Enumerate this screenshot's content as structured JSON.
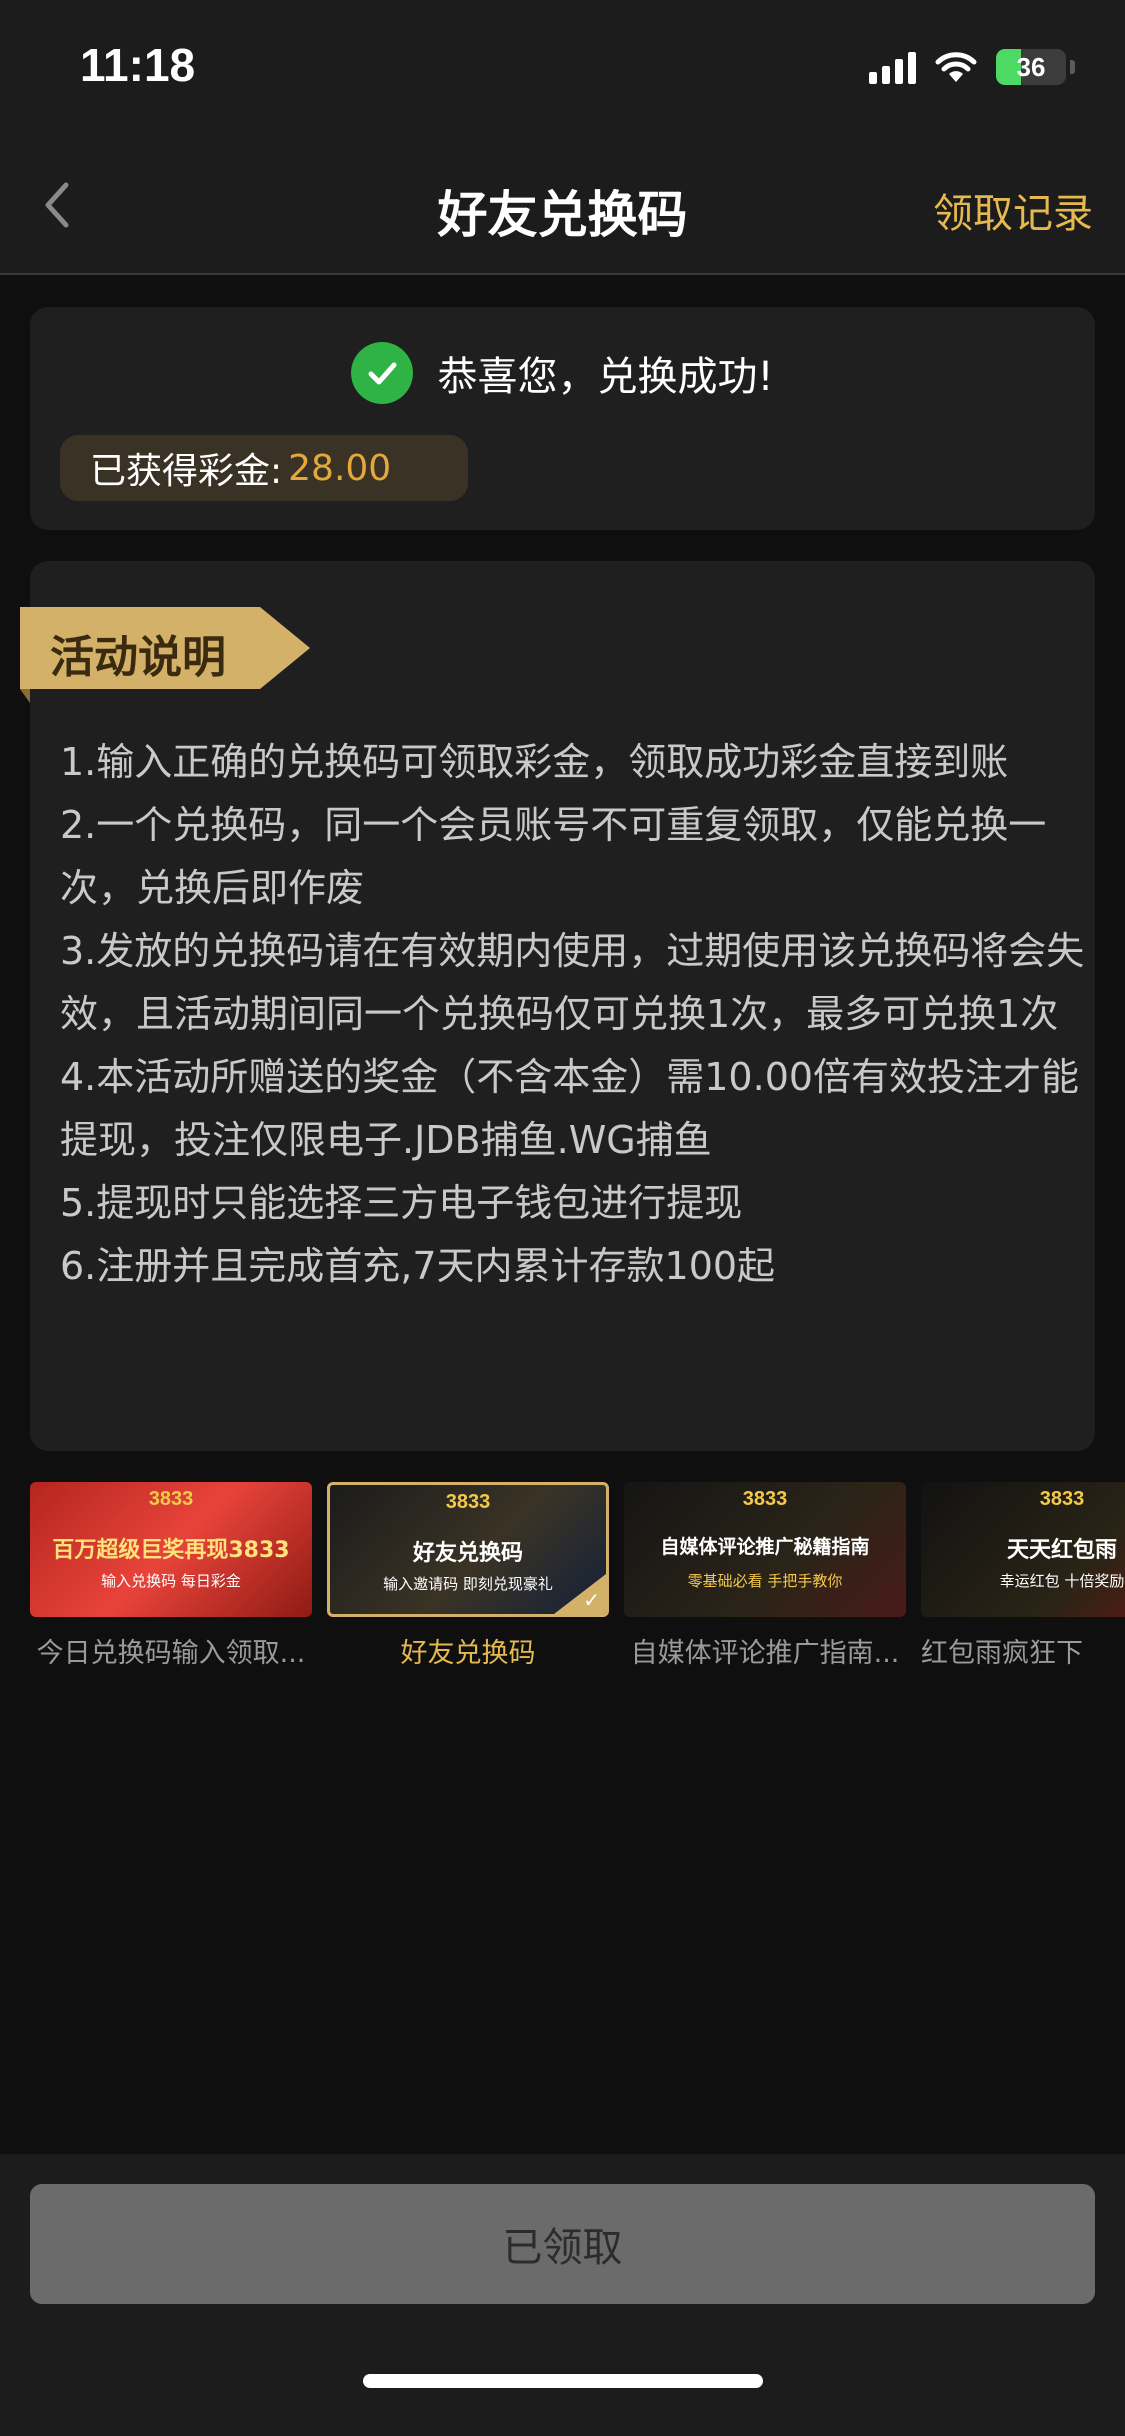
{
  "status_bar": {
    "time": "11:18",
    "battery": "36",
    "icons": [
      "signal-icon",
      "wifi-icon",
      "battery-icon"
    ]
  },
  "nav": {
    "title": "好友兑换码",
    "record_label": "领取记录",
    "back_icon": "chevron-left-icon"
  },
  "success": {
    "message": "恭喜您，兑换成功!",
    "bonus_label": "已获得彩金:",
    "bonus_value": "28.00",
    "icon": "check-circle-icon"
  },
  "rules": {
    "tag": "活动说明",
    "items": [
      "1.输入正确的兑换码可领取彩金，领取成功彩金直接到账",
      "2.一个兑换码，同一个会员账号不可重复领取，仅能兑换一次，兑换后即作废",
      "3.发放的兑换码请在有效期内使用，过期使用该兑换码将会失效，且活动期间同一个兑换码仅可兑换1次，最多可兑换1次",
      "4.本活动所赠送的奖金（不含本金）需10.00倍有效投注才能提现，投注仅限电子.JDB捕鱼.WG捕鱼",
      "5.提现时只能选择三方电子钱包进行提现",
      "6.注册并且完成首充,7天内累计存款100起"
    ]
  },
  "carousel": [
    {
      "caption": "今日兑换码输入领取...",
      "brand": "3833",
      "title": "百万超级巨奖再现3833",
      "sub": "输入兑换码 每日彩金",
      "active": false
    },
    {
      "caption": "好友兑换码",
      "brand": "3833",
      "title": "好友兑换码",
      "sub": "输入邀请码 即刻兑现豪礼",
      "active": true
    },
    {
      "caption": "自媒体评论推广指南...",
      "brand": "3833",
      "title": "自媒体评论推广秘籍指南",
      "sub": "零基础必看 手把手教你",
      "active": false
    },
    {
      "caption": "红包雨疯狂下",
      "brand": "3833",
      "title": "天天红包雨",
      "sub": "幸运红包 十倍奖励",
      "active": false
    }
  ],
  "bottom": {
    "claim_label": "已领取"
  },
  "colors": {
    "accent_gold": "#e5b94f",
    "success_green": "#2fb344",
    "bonus_orange": "#e5a93b"
  }
}
